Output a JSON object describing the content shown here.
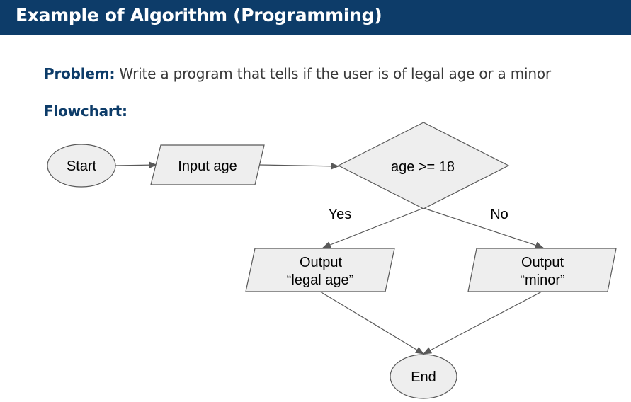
{
  "header": {
    "title": "Example of Algorithm (Programming)"
  },
  "problem": {
    "label": "Problem:",
    "text": " Write a program that tells if the user is of legal age or a minor"
  },
  "flowchart_label": "Flowchart:",
  "nodes": {
    "start": "Start",
    "input": "Input age",
    "decision": "age >= 18",
    "output_legal_line1": "Output",
    "output_legal_line2": "“legal age”",
    "output_minor_line1": "Output",
    "output_minor_line2": "“minor”",
    "end": "End"
  },
  "edges": {
    "yes": "Yes",
    "no": "No"
  },
  "colors": {
    "header_bg": "#0d3c69",
    "node_fill": "#eeeeee",
    "node_stroke": "#595959"
  }
}
